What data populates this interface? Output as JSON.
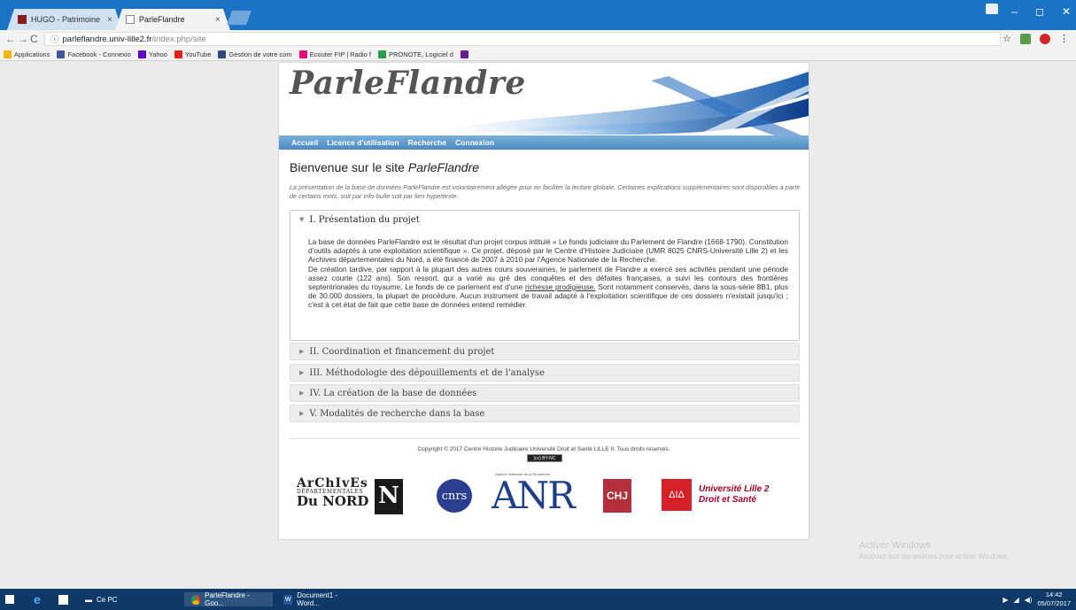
{
  "browser": {
    "tabs": [
      {
        "title": "HUGO - Patrimoine des",
        "close": "×"
      },
      {
        "title": "ParleFlandre",
        "close": "×"
      }
    ],
    "window_controls": {
      "minimize": "–",
      "maximize": "◻",
      "close": "✕"
    },
    "nav": {
      "back": "←",
      "forward": "→",
      "reload": "C",
      "info": "ⓘ"
    },
    "url_host": "parleflandre.univ-lille2.fr",
    "url_path": "/index.php/site",
    "star": "☆",
    "menu": "⋮",
    "bookmarks": [
      {
        "label": "Applications",
        "color": "#f4b400"
      },
      {
        "label": "Facebook - Connexio",
        "color": "#3b5998"
      },
      {
        "label": "Yahoo",
        "color": "#5f01d1"
      },
      {
        "label": "YouTube",
        "color": "#e62117"
      },
      {
        "label": "Gestion de votre com",
        "color": "#2c4a7a"
      },
      {
        "label": "Ecouter FIP | Radio f",
        "color": "#e6007e"
      },
      {
        "label": "PRONOTE, Logiciel d",
        "color": "#2a9d4a"
      },
      {
        "label": "",
        "color": "#6a1b9a"
      }
    ]
  },
  "site": {
    "logo": "ParleFlandre",
    "nav": [
      "Accueil",
      "Licence d'utilisation",
      "Recherche",
      "Connexion"
    ],
    "welcome_prefix": "Bienvenue sur le site ",
    "welcome_name": "ParleFlandre",
    "intro": "La présentation de la base de données ParleFlandre est volontairement allégée pour en faciliter la lecture globale. Certaines explications supplémentaires sont disponibles à partir de certains mots, soit par info-bulle soit par lien hypertexte.",
    "open_section": {
      "title": "I. Présentation du projet",
      "para1": "La base de données ParleFlandre est le résultat d'un projet corpus intitulé « Le fonds judiciaire du Parlement de Flandre (1668-1790). Constitution d'outils adaptés à une exploitation scientifique ». Ce projet, déposé par le Centre d'Histoire Judiciaire (UMR 8025 CNRS-Université Lille 2) et les Archives départementales du Nord, a été financé de 2007 à 2010 par l'Agence Nationale de la Recherche.",
      "para2_start": "De création tardive, par rapport à la plupart des autres cours souveraines, le parlement de Flandre a exercé ses activités pendant une période assez courte (122 ans). Son ressort, qui a varié au gré des conquêtes et des défaites françaises, a suivi les contours des frontières septentrionales du royaume. Le fonds de ce parlement est d'une ",
      "para2_link": "richesse prodigieuse.",
      "para2_end": " Sont notamment conservés, dans la sous-série 8B1, plus de 30.000 dossiers, la plupart de procédure. Aucun instrument de travail adapté à l'exploitation scientifique de ces dossiers n'existait jusqu'ici ; c'est à cet état de fait que cette base de données entend remédier."
    },
    "sections": [
      "II. Coordination et financement du projet",
      "III. Méthodologie des dépouillements et de l'analyse",
      "IV. La création de la base de données",
      "V. Modalités de recherche dans la base"
    ],
    "copyright": "Copyright © 2017 Centre Histoire Judiciaire Université Droit et Santé LILLE II. Tous droits réservés.",
    "cc_badge": "(cc) BY-NC",
    "partners": {
      "archives_line1": "ArChIvEs",
      "archives_line2": "DÉPARTEMENTALES",
      "archives_line3": "Du NORD",
      "archives_mark": "N",
      "cnrs": "cnrs",
      "anr_caption": "Agence Nationale de la Recherche",
      "anr": "ANR",
      "chj": "CHJ",
      "lille_mark": "ΔΙΔ",
      "lille_line1": "Université Lille 2",
      "lille_line2": "Droit et Santé"
    }
  },
  "os": {
    "activate_title": "Activer Windows",
    "activate_sub": "Accédez aux paramètres pour activer Windows.",
    "taskbar": {
      "pc_label": "Ce PC",
      "chrome_label": "ParleFlandre - Goo...",
      "word_label": "Document1 - Word...",
      "time": "14:42",
      "date": "05/07/2017"
    }
  }
}
